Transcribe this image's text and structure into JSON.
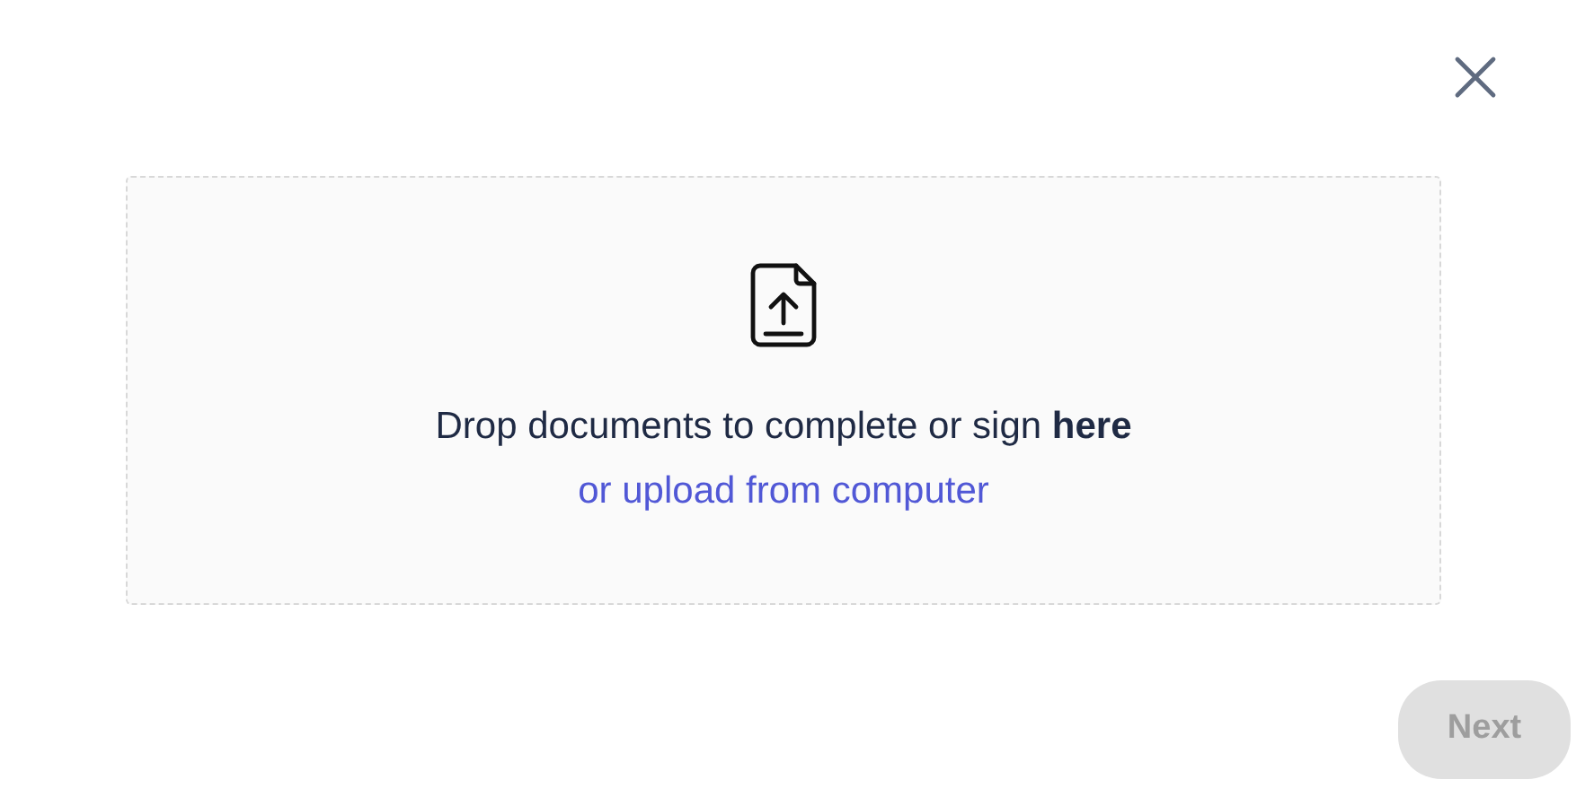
{
  "dropzone": {
    "message": "Drop documents to complete or sign **here**",
    "upload_link": "or upload from computer"
  },
  "next_button": {
    "label": "Next",
    "disabled": true
  }
}
